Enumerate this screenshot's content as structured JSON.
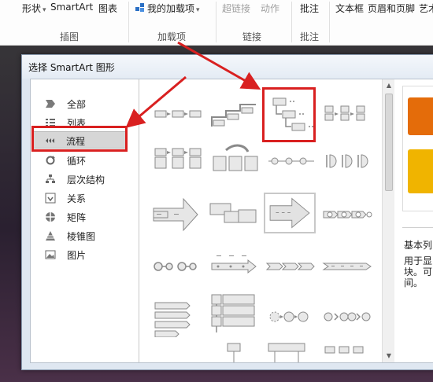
{
  "ribbon": {
    "top": {
      "shape": "形状",
      "smartart": "SmartArt",
      "chart": "图表",
      "my_addins": "我的加载项",
      "hyperlink": "超链接",
      "action": "动作",
      "comment": "批注",
      "textbox": "文本框",
      "header_footer": "页眉和页脚",
      "art": "艺术"
    },
    "groups": {
      "illustrations": "插图",
      "addins": "加载项",
      "links": "链接",
      "comments": "批注"
    }
  },
  "dialog": {
    "title": "选择 SmartArt 图形",
    "categories": [
      {
        "label": "全部",
        "icon": "all-icon"
      },
      {
        "label": "列表",
        "icon": "list-icon"
      },
      {
        "label": "流程",
        "icon": "process-icon"
      },
      {
        "label": "循环",
        "icon": "cycle-icon"
      },
      {
        "label": "层次结构",
        "icon": "hierarchy-icon"
      },
      {
        "label": "关系",
        "icon": "relationship-icon"
      },
      {
        "label": "矩阵",
        "icon": "matrix-icon"
      },
      {
        "label": "棱锥图",
        "icon": "pyramid-icon"
      },
      {
        "label": "图片",
        "icon": "picture-icon"
      }
    ],
    "selected_category": "流程",
    "preview": {
      "name": "基本列",
      "desc_lines": [
        "用于显",
        "块。可",
        "间。"
      ]
    }
  },
  "colors": {
    "annotation_red": "#d92020",
    "preview_orange": "#e46c0a",
    "preview_yellow": "#f0b400"
  }
}
